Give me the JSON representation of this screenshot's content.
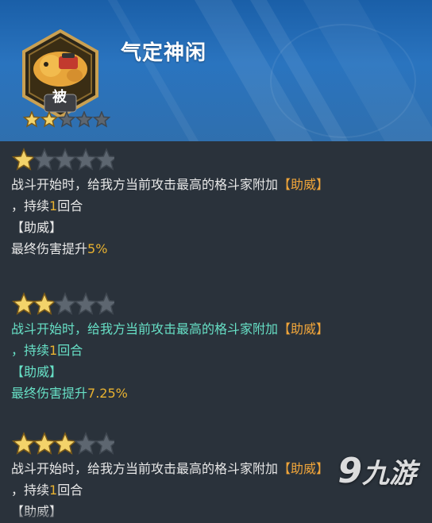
{
  "skill": {
    "title": "气定神闲",
    "type_label": "被",
    "header_stars": {
      "filled": 2,
      "total": 5
    }
  },
  "tiers": [
    {
      "stars": {
        "filled": 1,
        "total": 5
      },
      "line1_text": "战斗开始时，给我方当前攻击最高的格斗家附加",
      "line1_highlight": "【助威】",
      "line2_prefix": "，持续",
      "line2_number": "1",
      "line2_suffix": "回合",
      "buff_tag": "【助威】",
      "effect_text": "最终伤害提升",
      "effect_value": "5%"
    },
    {
      "stars": {
        "filled": 2,
        "total": 5
      },
      "line1_text": "战斗开始时，给我方当前攻击最高的格斗家附加",
      "line1_highlight": "【助威】",
      "line2_prefix": "，持续",
      "line2_number": "1",
      "line2_suffix": "回合",
      "buff_tag": "【助威】",
      "effect_text": "最终伤害提升",
      "effect_value": "7.25%"
    },
    {
      "stars": {
        "filled": 3,
        "total": 5
      },
      "line1_text": "战斗开始时，给我方当前攻击最高的格斗家附加",
      "line1_highlight": "【助威】",
      "line2_prefix": "，持续",
      "line2_number": "1",
      "line2_suffix": "回合",
      "buff_tag": "【助威】"
    }
  ],
  "watermark": {
    "nine": "9",
    "text": "九游"
  },
  "colors": {
    "header_blue": "#2a74bf",
    "panel_bg": "#2a323b",
    "highlight_orange": "#f0a53a",
    "active_cyan": "#67e0c6",
    "star_gold": "#f3d36a",
    "star_gray": "#5d6670"
  }
}
